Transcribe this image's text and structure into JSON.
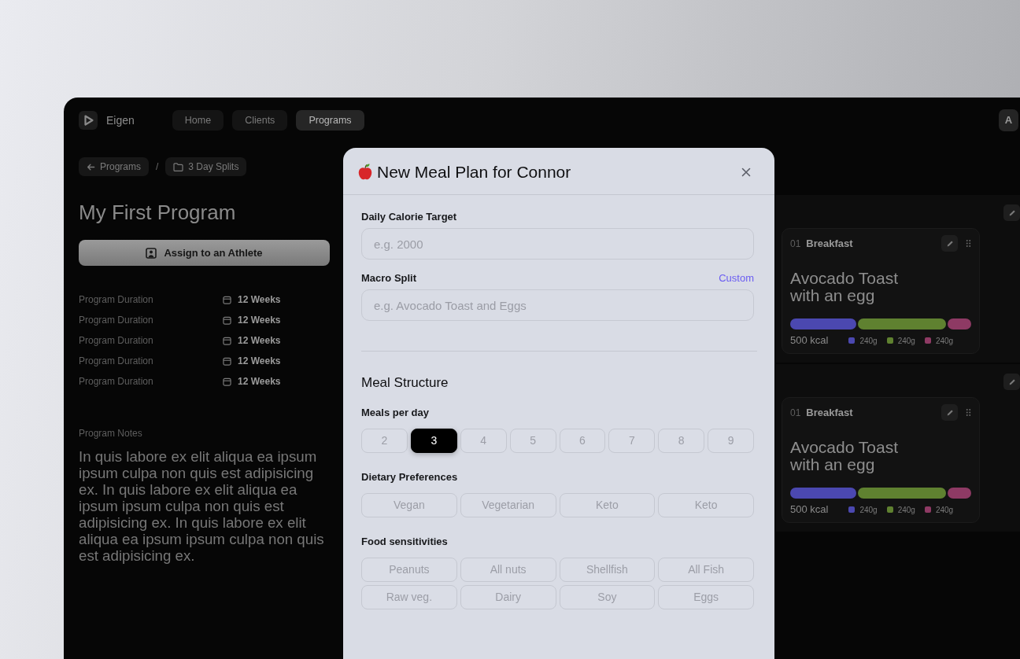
{
  "app": {
    "brand": "Eigen",
    "nav": [
      {
        "label": "Home",
        "selected": false
      },
      {
        "label": "Clients",
        "selected": false
      },
      {
        "label": "Programs",
        "selected": true
      }
    ],
    "avatar": "A",
    "breadcrumb": [
      {
        "label": "Programs",
        "kind": "back"
      },
      {
        "label": "3 Day Splits",
        "kind": "folder"
      }
    ],
    "breadcrumb_separator": "/",
    "title": "My First Program",
    "assign_button": "Assign to an Athlete",
    "details": [
      {
        "label": "Program Duration",
        "value": "12 Weeks"
      },
      {
        "label": "Program Duration",
        "value": "12 Weeks"
      },
      {
        "label": "Program Duration",
        "value": "12 Weeks"
      },
      {
        "label": "Program Duration",
        "value": "12 Weeks"
      },
      {
        "label": "Program Duration",
        "value": "12 Weeks"
      }
    ],
    "notes_label": "Program Notes",
    "notes": "In quis labore ex elit aliqua ea ipsum ipsum culpa non quis est adipisicing ex. In quis labore ex elit aliqua ea ipsum ipsum culpa non quis est adipisicing ex. In quis labore ex elit aliqua ea ipsum ipsum culpa non quis est adipisicing ex.",
    "meals": [
      {
        "number": "01",
        "name": "Breakfast",
        "dish": "Avocado Toast with an egg",
        "calories": "500 kcal",
        "macros": [
          {
            "amount": "240g",
            "color": "#4b48b0"
          },
          {
            "amount": "240g",
            "color": "#5f8130"
          },
          {
            "amount": "240g",
            "color": "#8e3a64"
          }
        ]
      },
      {
        "number": "01",
        "name": "Breakfast",
        "dish": "Avocado Toast with an egg",
        "calories": "500 kcal",
        "macros": [
          {
            "amount": "240g",
            "color": "#4b48b0"
          },
          {
            "amount": "240g",
            "color": "#5f8130"
          },
          {
            "amount": "240g",
            "color": "#8e3a64"
          }
        ]
      }
    ]
  },
  "modal": {
    "title": "New Meal Plan for Connor",
    "fields": [
      {
        "label": "Daily Calorie Target",
        "placeholder": "e.g. 2000"
      },
      {
        "label": "Macro Split",
        "link": "Custom",
        "placeholder": "e.g. Avocado Toast and Eggs"
      }
    ],
    "section_title": "Meal Structure",
    "groups": [
      {
        "label": "Meals per day",
        "kind": "number",
        "options": [
          {
            "label": "2",
            "selected": false
          },
          {
            "label": "3",
            "selected": true
          },
          {
            "label": "4",
            "selected": false
          },
          {
            "label": "5",
            "selected": false
          },
          {
            "label": "6",
            "selected": false
          },
          {
            "label": "7",
            "selected": false
          },
          {
            "label": "8",
            "selected": false
          },
          {
            "label": "9",
            "selected": false
          }
        ]
      },
      {
        "label": "Dietary Preferences",
        "kind": "chip",
        "options": [
          {
            "label": "Vegan",
            "selected": false
          },
          {
            "label": "Vegetarian",
            "selected": false
          },
          {
            "label": "Keto",
            "selected": false
          },
          {
            "label": "Keto",
            "selected": false
          }
        ]
      },
      {
        "label": "Food sensitivities",
        "kind": "chip",
        "options": [
          {
            "label": "Peanuts",
            "selected": false
          },
          {
            "label": "All nuts",
            "selected": false
          },
          {
            "label": "Shellfish",
            "selected": false
          },
          {
            "label": "All Fish",
            "selected": false
          },
          {
            "label": "Raw veg.",
            "selected": false
          },
          {
            "label": "Dairy",
            "selected": false
          },
          {
            "label": "Soy",
            "selected": false
          },
          {
            "label": "Eggs",
            "selected": false
          }
        ]
      }
    ]
  }
}
